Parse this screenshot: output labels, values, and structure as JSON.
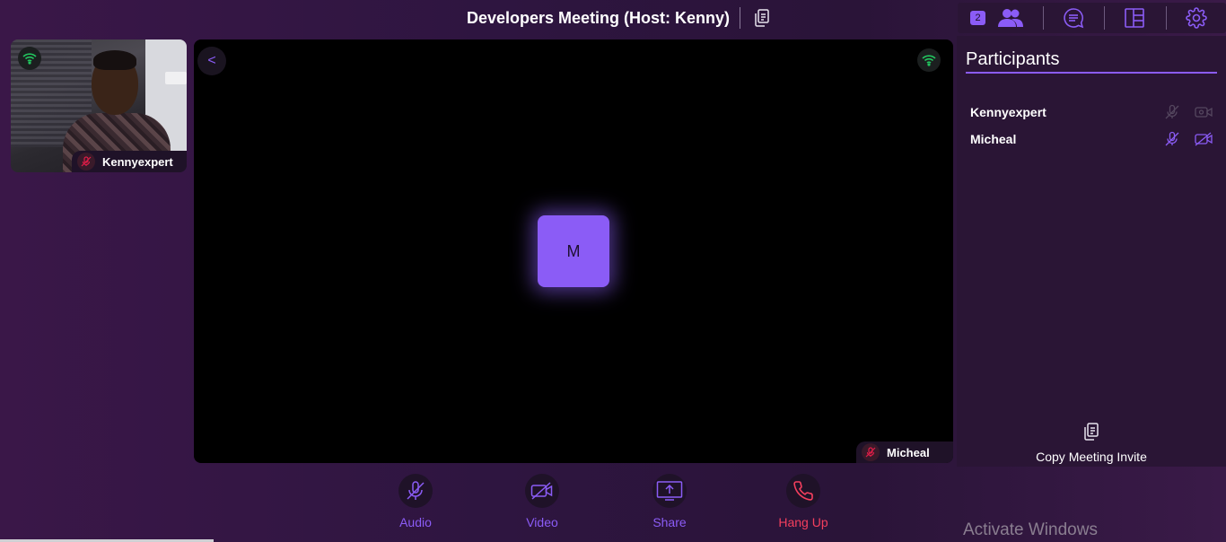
{
  "header": {
    "meeting_title": "Developers Meeting (Host: Kenny)"
  },
  "top_controls": {
    "participant_count": "2"
  },
  "self_view": {
    "name": "Kennyexpert"
  },
  "main_stage": {
    "back_label": "<",
    "avatar_initial": "M",
    "name": "Micheal"
  },
  "participants_panel": {
    "title": "Participants",
    "participants": [
      {
        "name": "Kennyexpert",
        "mic": "muted",
        "video": "off"
      },
      {
        "name": "Micheal",
        "mic": "muted",
        "video": "off"
      }
    ],
    "copy_invite_label": "Copy Meeting Invite"
  },
  "controls": {
    "audio_label": "Audio",
    "video_label": "Video",
    "share_label": "Share",
    "hangup_label": "Hang Up"
  },
  "watermark": {
    "text": "Activate Windows"
  },
  "colors": {
    "accent": "#8b5cf6",
    "hangup": "#f43f5e",
    "signal": "#22c55e",
    "muted_mic": "#e11d48"
  }
}
